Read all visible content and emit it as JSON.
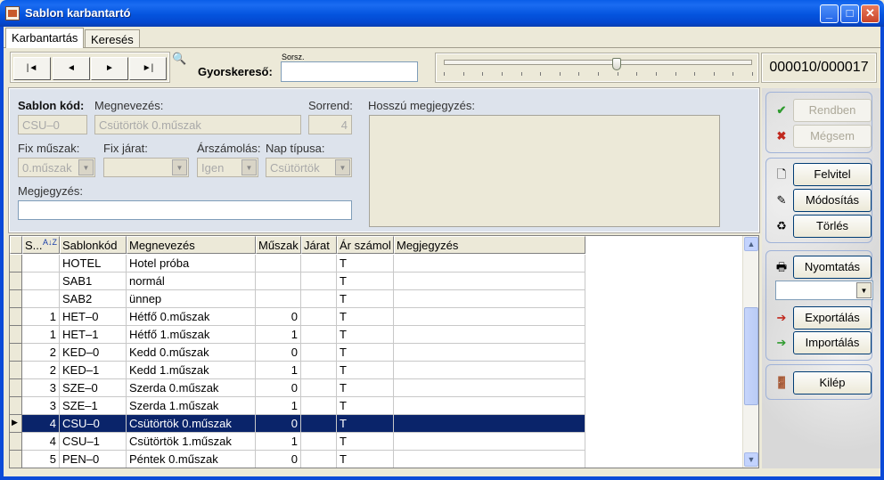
{
  "window": {
    "title": "Sablon karbantartó",
    "minimize": "_",
    "maximize": "□",
    "close": "✕"
  },
  "tabs": [
    {
      "label": "Karbantartás"
    },
    {
      "label": "Keresés"
    }
  ],
  "nav": {
    "first": "|◄",
    "prev": "◄",
    "next": "►",
    "last": "►|"
  },
  "quicksearch": {
    "label": "Gyorskereső:",
    "sublabel": "Sorsz.",
    "value": ""
  },
  "slider": {
    "position": 0.56
  },
  "counter": "000010/000017",
  "form": {
    "code_label": "Sablon kód:",
    "code_value": "CSU–0",
    "name_label": "Megnevezés:",
    "name_value": "Csütörtök 0.műszak",
    "order_label": "Sorrend:",
    "order_value": "4",
    "long_note_label": "Hosszú megjegyzés:",
    "fix_shift_label": "Fix műszak:",
    "fix_shift_value": "0.műszak",
    "fix_route_label": "Fix járat:",
    "fix_route_value": "",
    "pricing_label": "Árszámolás:",
    "pricing_value": "Igen",
    "daytype_label": "Nap típusa:",
    "daytype_value": "Csütörtök",
    "note_label": "Megjegyzés:",
    "note_value": ""
  },
  "grid": {
    "columns": [
      "S...",
      "Sablonkód",
      "Megnevezés",
      "Műszak",
      "Járat",
      "Ár számol",
      "Megjegyzés"
    ],
    "sort_icon": "A↓Z",
    "rows": [
      {
        "s": "",
        "code": "HOTEL",
        "name": "Hotel próba",
        "shift": "",
        "route": "",
        "price": "T",
        "note": ""
      },
      {
        "s": "",
        "code": "SAB1",
        "name": "normál",
        "shift": "",
        "route": "",
        "price": "T",
        "note": ""
      },
      {
        "s": "",
        "code": "SAB2",
        "name": "ünnep",
        "shift": "",
        "route": "",
        "price": "T",
        "note": ""
      },
      {
        "s": "1",
        "code": "HET–0",
        "name": "Hétfő 0.műszak",
        "shift": "0",
        "route": "",
        "price": "T",
        "note": ""
      },
      {
        "s": "1",
        "code": "HET–1",
        "name": "Hétfő 1.műszak",
        "shift": "1",
        "route": "",
        "price": "T",
        "note": ""
      },
      {
        "s": "2",
        "code": "KED–0",
        "name": "Kedd 0.műszak",
        "shift": "0",
        "route": "",
        "price": "T",
        "note": ""
      },
      {
        "s": "2",
        "code": "KED–1",
        "name": "Kedd 1.műszak",
        "shift": "1",
        "route": "",
        "price": "T",
        "note": ""
      },
      {
        "s": "3",
        "code": "SZE–0",
        "name": "Szerda 0.műszak",
        "shift": "0",
        "route": "",
        "price": "T",
        "note": ""
      },
      {
        "s": "3",
        "code": "SZE–1",
        "name": "Szerda 1.műszak",
        "shift": "1",
        "route": "",
        "price": "T",
        "note": ""
      },
      {
        "s": "4",
        "code": "CSU–0",
        "name": "Csütörtök 0.műszak",
        "shift": "0",
        "route": "",
        "price": "T",
        "note": ""
      },
      {
        "s": "4",
        "code": "CSU–1",
        "name": "Csütörtök 1.műszak",
        "shift": "1",
        "route": "",
        "price": "T",
        "note": ""
      },
      {
        "s": "5",
        "code": "PEN–0",
        "name": "Péntek 0.műszak",
        "shift": "0",
        "route": "",
        "price": "T",
        "note": ""
      }
    ],
    "selected_row": 9,
    "row_pointer": "▶",
    "scroll_up": "▲",
    "scroll_down": "▼"
  },
  "actions": {
    "ok": "Rendben",
    "cancel": "Mégsem",
    "add": "Felvitel",
    "edit": "Módosítás",
    "delete": "Törlés",
    "print": "Nyomtatás",
    "print_target": "",
    "export": "Exportálás",
    "import": "Importálás",
    "exit": "Kilép"
  },
  "icons": {
    "ok": "checkmark-icon",
    "cancel": "x-icon",
    "add": "new-document-icon",
    "edit": "edit-document-icon",
    "delete": "delete-document-icon",
    "print": "printer-icon",
    "export": "export-icon",
    "import": "import-icon",
    "exit": "exit-door-icon",
    "search": "magnifier-icon"
  },
  "colors": {
    "selection": "#0a246a",
    "titlebar": "#0454de",
    "ok_icon": "#2f9b2f",
    "cancel_icon": "#c0281e"
  }
}
